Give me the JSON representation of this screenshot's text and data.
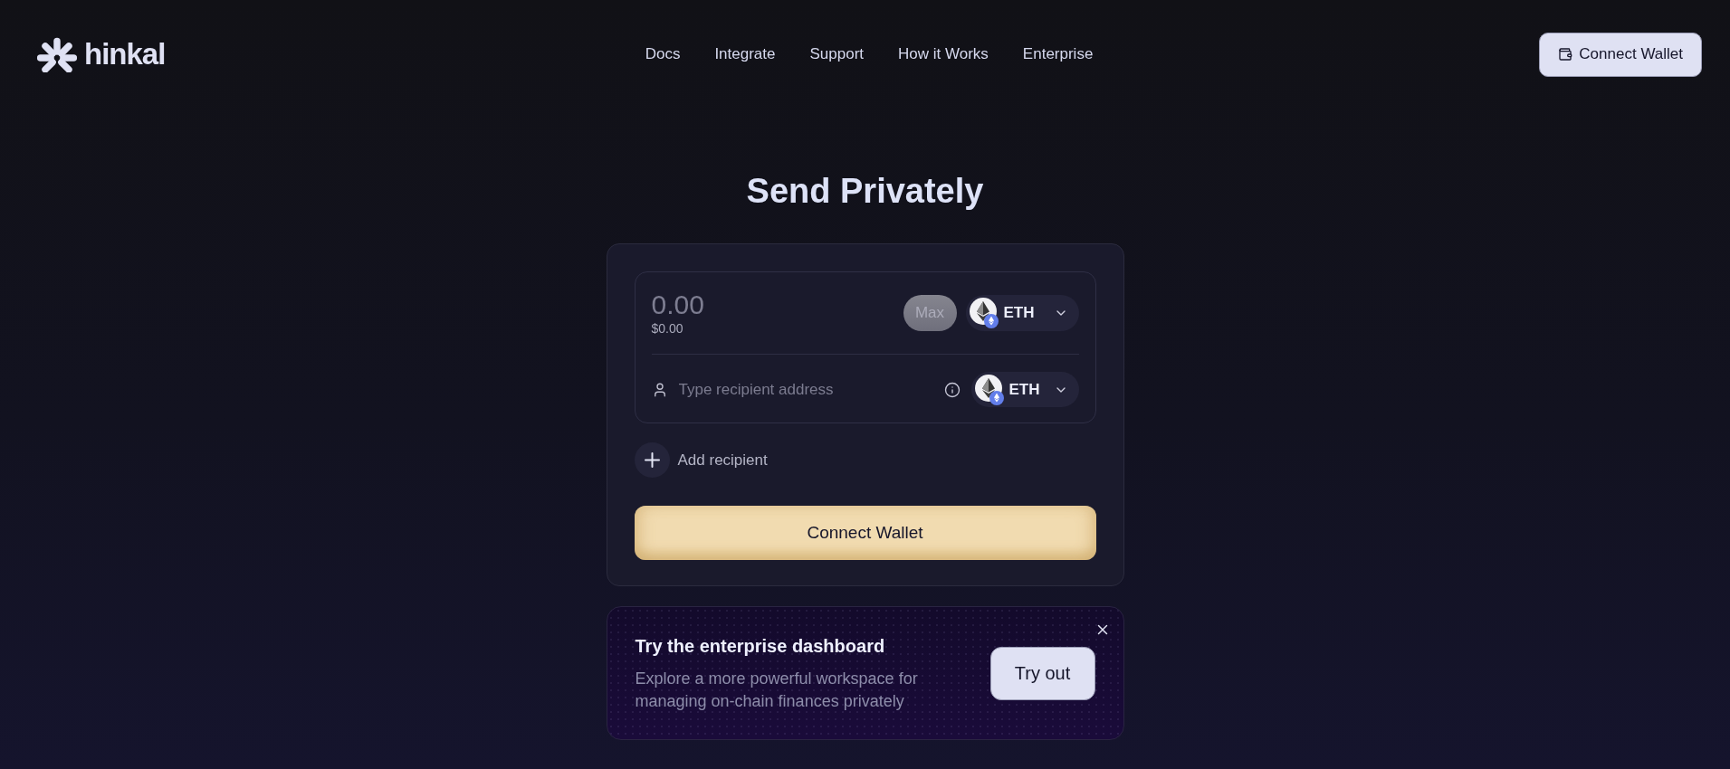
{
  "header": {
    "logo": "hinkal",
    "nav": [
      "Docs",
      "Integrate",
      "Support",
      "How it Works",
      "Enterprise"
    ],
    "connect_button": "Connect Wallet"
  },
  "title": "Send Privately",
  "send_form": {
    "amount": {
      "placeholder": "0.00"
    },
    "fiat_value": "$0.00",
    "max_button": {
      "label": "Max",
      "disabled": true
    },
    "token": "ETH",
    "recipient": {
      "placeholder": "Type recipient address",
      "token": "ETH"
    },
    "add_recipient": "Add recipient",
    "submit_button": "Connect Wallet"
  },
  "promo": {
    "title": "Try the enterprise dashboard",
    "text": "Explore a more powerful workspace for managing on-chain finances privately",
    "button": "Try out"
  }
}
